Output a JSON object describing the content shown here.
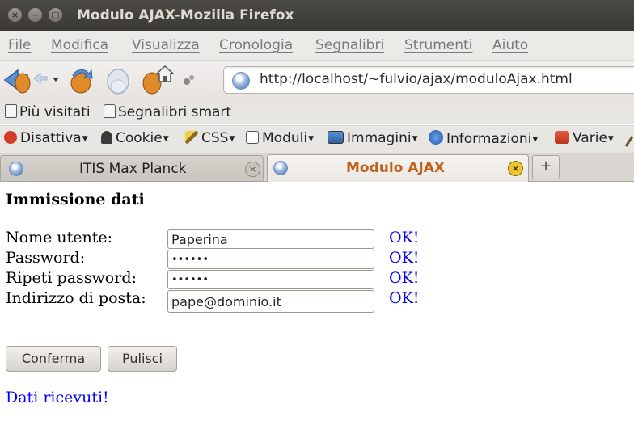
{
  "window": {
    "title": "Modulo AJAX-Mozilla Firefox",
    "buttons": {
      "close": "×",
      "minimize": "−",
      "maximize": "□"
    }
  },
  "menu": [
    "File",
    "Modifica",
    "Visualizza",
    "Cronologia",
    "Segnalibri",
    "Strumenti",
    "Aiuto"
  ],
  "navigation": {
    "url": "http://localhost/~fulvio/ajax/moduloAjax.html"
  },
  "bookmarks": {
    "most_visited": "Più visitati",
    "smart": "Segnalibri smart"
  },
  "devtoolbar": [
    "Disattiva",
    "Cookie",
    "CSS",
    "Moduli",
    "Immagini",
    "Informazioni",
    "Varie"
  ],
  "tabs": [
    {
      "title": "ITIS Max Planck",
      "active": false
    },
    {
      "title": "Modulo AJAX",
      "active": true
    }
  ],
  "newtab_label": "+",
  "page": {
    "heading": "Immissione dati",
    "fields": [
      {
        "label": "Nome utente:",
        "value": "Paperina",
        "status": "OK!"
      },
      {
        "label": "Password:",
        "value": "••••••",
        "status": "OK!"
      },
      {
        "label": "Ripeti password:",
        "value": "••••••",
        "status": "OK!"
      },
      {
        "label": "Indirizzo di posta:",
        "value": "pape@dominio.it",
        "status": "OK!"
      }
    ],
    "buttons": {
      "confirm": "Conferma",
      "clear": "Pulisci"
    },
    "status_message": "Dati ricevuti!"
  },
  "colors": {
    "titlebar": "#3f3e3a",
    "active_tab_text": "#c0601c",
    "ok_text": "#0000ff",
    "close_button": "#f0c330"
  }
}
